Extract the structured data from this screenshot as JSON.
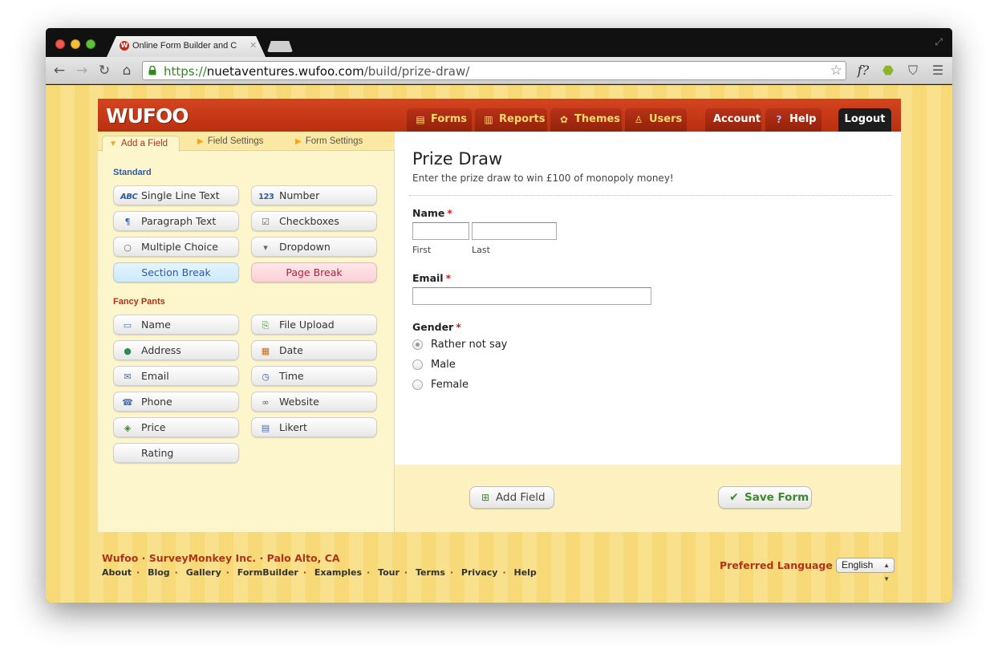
{
  "browser": {
    "tab_title": "Online Form Builder and C",
    "tab_close": "✕",
    "url_scheme": "https://",
    "url_host": "nuetaventures.wufoo.com",
    "url_path": "/build/prize-draw/"
  },
  "header": {
    "logo": "WUFOO",
    "nav": [
      {
        "label": "Forms",
        "icon": "forms-icon"
      },
      {
        "label": "Reports",
        "icon": "reports-icon"
      },
      {
        "label": "Themes",
        "icon": "themes-icon"
      },
      {
        "label": "Users",
        "icon": "users-icon"
      },
      {
        "label": "Account"
      },
      {
        "label": "Help",
        "icon": "help-icon"
      },
      {
        "label": "Logout"
      }
    ]
  },
  "sidebar": {
    "tabs": [
      "Add a Field",
      "Field Settings",
      "Form Settings"
    ],
    "standard_label": "Standard",
    "standard_fields": [
      "Single Line Text",
      "Number",
      "Paragraph Text",
      "Checkboxes",
      "Multiple Choice",
      "Dropdown",
      "Section Break",
      "Page Break"
    ],
    "fancy_label": "Fancy Pants",
    "fancy_fields": [
      "Name",
      "File Upload",
      "Address",
      "Date",
      "Email",
      "Time",
      "Phone",
      "Website",
      "Price",
      "Likert",
      "Rating"
    ]
  },
  "form": {
    "title": "Prize Draw",
    "description": "Enter the prize draw to win £100 of monopoly money!",
    "name_label": "Name",
    "required_mark": "*",
    "first_label": "First",
    "last_label": "Last",
    "email_label": "Email",
    "gender_label": "Gender",
    "gender_options": [
      "Rather not say",
      "Male",
      "Female"
    ],
    "selected_gender": "Rather not say"
  },
  "actions": {
    "add_field": "Add Field",
    "save_form": "Save Form"
  },
  "footer": {
    "brand": "Wufoo · SurveyMonkey Inc. · Palo Alto, CA",
    "links": [
      "About",
      "Blog",
      "Gallery",
      "FormBuilder",
      "Examples",
      "Tour",
      "Terms",
      "Privacy",
      "Help"
    ],
    "link_separator": "·",
    "preferred_language_label": "Preferred Language :",
    "language": "English"
  },
  "colors": {
    "brand_red": "#c73a18",
    "nav_gold": "#ffd86a",
    "panel_yellow": "#fdf5cc",
    "required_red": "#d02121",
    "save_green": "#3d8a2c"
  }
}
